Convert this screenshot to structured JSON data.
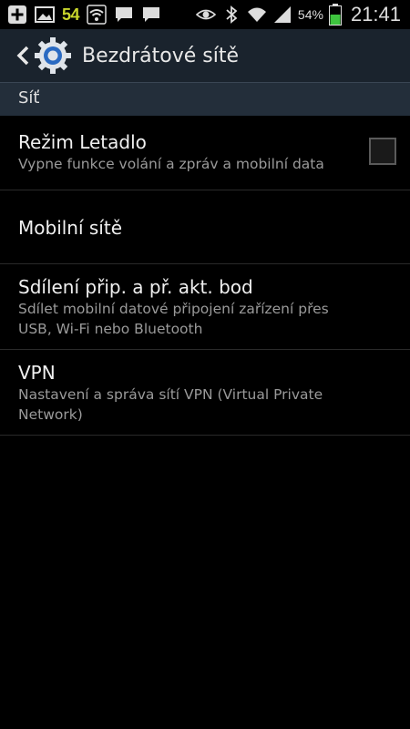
{
  "status_bar": {
    "notification_count": "54",
    "battery_percent": "54%",
    "time": "21:41",
    "icons": [
      "add-box-icon",
      "gallery-icon",
      "wifi-notification-icon",
      "chat-icon",
      "chat-icon",
      "eye-icon",
      "bluetooth-icon",
      "wifi-icon",
      "signal-icon",
      "battery-charging-icon"
    ]
  },
  "action_bar": {
    "title": "Bezdrátové sítě",
    "icons": [
      "back-arrow-icon",
      "settings-gear-icon"
    ]
  },
  "section": {
    "header": "Síť"
  },
  "items": [
    {
      "title": "Režim Letadlo",
      "summary": "Vypne funkce volání a zpráv a mobilní data",
      "checked": false
    },
    {
      "title": "Mobilní sítě"
    },
    {
      "title": "Sdílení přip. a př. akt. bod",
      "summary_line1": "Sdílet mobilní datové připojení zařízení přes",
      "summary_line2": "USB, Wi-Fi nebo Bluetooth"
    },
    {
      "title": "VPN",
      "summary_line1": "Nastavení a správa sítí VPN (Virtual Private",
      "summary_line2": "Network)"
    }
  ],
  "colors": {
    "accent_green": "#c9d62c",
    "action_bar_bg": "#1a232d",
    "section_header_bg": "#232e3a",
    "battery_green": "#3ec43e"
  }
}
